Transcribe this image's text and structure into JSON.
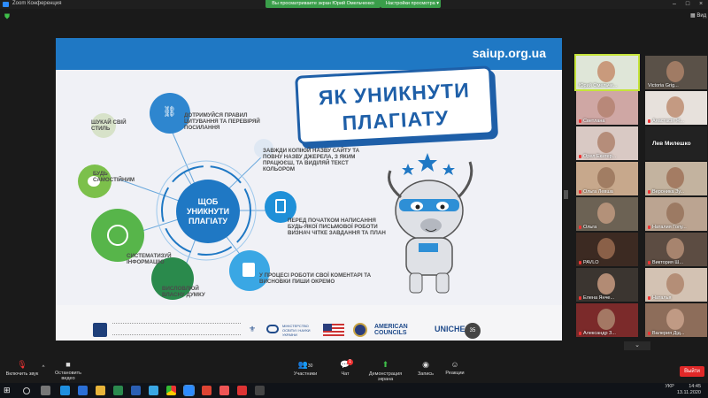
{
  "window": {
    "app_title": "Zoom Конференция"
  },
  "share_banner": {
    "text": "Вы просматриваете экран Юрий Омельченко",
    "options_label": "Настройки просмотра"
  },
  "top_right": {
    "view_label": "Вид"
  },
  "slide": {
    "site": "saiup.org.ua",
    "title_line1": "ЯК УНИКНУТИ",
    "title_line2": "ПЛАГІАТУ",
    "center_text": "ЩОБ УНИКНУТИ ПЛАГІАТУ",
    "tips": {
      "style": "ШУКАЙ СВІЙ СТИЛЬ",
      "citation": "ДОТРИМУЙСЯ ПРАВИЛ ЦИТУВАННЯ ТА ПЕРЕВІРЯЙ ПОСИЛАННЯ",
      "copy": "ЗАВЖДИ КОПІЮЙ НАЗВУ САЙТУ ТА ПОВНУ НАЗВУ ДЖЕРЕЛА, З ЯКИМ ПРАЦЮЄШ, ТА ВИДІЛЯЙ ТЕКСТ КОЛЬОРОМ",
      "independent": "БУДЬ САМОСТІЙНИМ",
      "plan": "ПЕРЕД ПОЧАТКОМ НАПИСАННЯ БУДЬ-ЯКОЇ ПИСЬМОВОЇ РОБОТИ ВИЗНАЧ ЧІТКЕ ЗАВДАННЯ ТА ПЛАН",
      "systematize": "СИСТЕМАТИЗУЙ ІНФОРМАЦІЮ",
      "comments": "У ПРОЦЕСІ РОБОТИ СВОЇ КОМЕНТАРІ ТА ВИСНОВКИ ПИШИ ОКРЕМО",
      "opinion": "ВИСЛОВЛЮЙ ВЛАСНУ ДУМКУ"
    },
    "logos": {
      "ministry": "МІНІСТЕРСТВО ОСВІТИ І НАУКИ УКРАЇНИ",
      "american_councils": "AMERICAN COUNCILS",
      "unicheck": "UNICHECK"
    },
    "page_number": "35"
  },
  "participants": [
    {
      "name": "Юрий Омельче...",
      "active": true,
      "muted": false,
      "bg": "#dfe6d8",
      "face": "#c99a7c"
    },
    {
      "name": "Victoria Grig...",
      "active": false,
      "muted": false,
      "bg": "#5a5148",
      "face": "#a07b64"
    },
    {
      "name": "Светлана",
      "active": false,
      "muted": true,
      "bg": "#cfa7a4",
      "face": "#b88879"
    },
    {
      "name": "Анастасія Ж...",
      "active": false,
      "muted": true,
      "bg": "#e7e1dc",
      "face": "#c49a82"
    },
    {
      "name": "Орел Екатер...",
      "active": false,
      "muted": true,
      "bg": "#d9c9c4",
      "face": "#b58d7a"
    },
    {
      "name": "Лев Милешко",
      "active": false,
      "muted": false,
      "bg": "#222222",
      "face": ""
    },
    {
      "name": "Ольга Левша",
      "active": false,
      "muted": true,
      "bg": "#c7a88c",
      "face": "#a17d63"
    },
    {
      "name": "Вероника Зу...",
      "active": false,
      "muted": true,
      "bg": "#c3b39f",
      "face": "#a47c63"
    },
    {
      "name": "Ольга",
      "active": false,
      "muted": true,
      "bg": "#6c6254",
      "face": "#b39179"
    },
    {
      "name": "Наталия Голу...",
      "active": false,
      "muted": true,
      "bg": "#bba491",
      "face": "#9c7a63"
    },
    {
      "name": "PAVLO",
      "active": false,
      "muted": true,
      "bg": "#3c2a22",
      "face": "#8a6048"
    },
    {
      "name": "Виктория Ш...",
      "active": false,
      "muted": true,
      "bg": "#5c4c42",
      "face": "#a7846e"
    },
    {
      "name": "Елена Янче...",
      "active": false,
      "muted": true,
      "bg": "#3b3530",
      "face": "#b28b74"
    },
    {
      "name": "Наталья",
      "active": false,
      "muted": true,
      "bg": "#d3c2b3",
      "face": "#b48e77"
    },
    {
      "name": "Александр З...",
      "active": false,
      "muted": true,
      "bg": "#7b2a2a",
      "face": "#a47864"
    },
    {
      "name": "Валерия Дід...",
      "active": false,
      "muted": true,
      "bg": "#8d6d5a",
      "face": "#c09a84"
    }
  ],
  "toolbar": {
    "audio": "Включить звук",
    "video": "Остановить видео",
    "participants": "Участники",
    "participants_count": "30",
    "chat": "Чат",
    "chat_badge": "1",
    "share": "Демонстрация экрана",
    "record": "Запись",
    "reactions": "Реакции",
    "leave": "Выйти"
  },
  "taskbar": {
    "lang": "УКР",
    "time": "14:45",
    "date": "13.11.2020"
  }
}
